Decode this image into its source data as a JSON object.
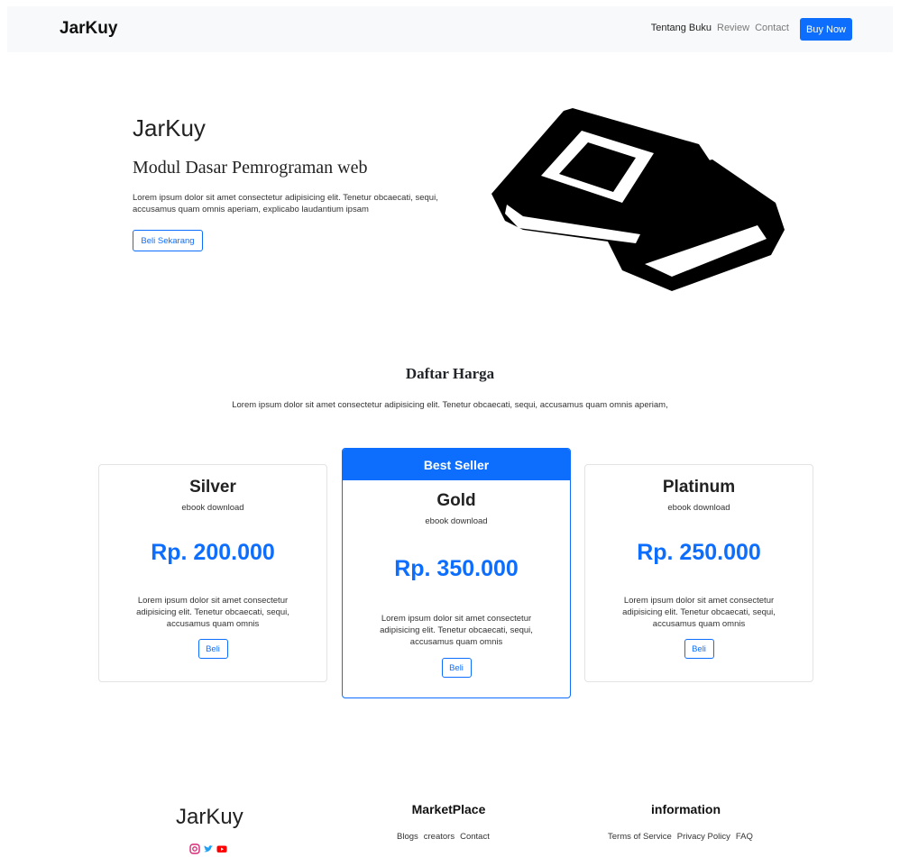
{
  "nav": {
    "brand": "JarKuy",
    "links": [
      "Tentang Buku",
      "Review",
      "Contact"
    ],
    "cta": "Buy Now"
  },
  "hero": {
    "title": "JarKuy",
    "subtitle": "Modul Dasar Pemrograman web",
    "text": "Lorem ipsum dolor sit amet consectetur adipisicing elit. Tenetur obcaecati, sequi, accusamus quam omnis aperiam, explicabo laudantium ipsam",
    "button": "Beli Sekarang",
    "image_icon": "books-icon"
  },
  "pricing": {
    "title": "Daftar Harga",
    "text": "Lorem ipsum dolor sit amet consectetur adipisicing elit. Tenetur obcaecati, sequi, accusamus quam omnis aperiam,",
    "plans": [
      {
        "name": "Silver",
        "desc": "ebook download",
        "price": "Rp. 200.000",
        "text": "Lorem ipsum dolor sit amet consectetur adipisicing elit. Tenetur obcaecati, sequi, accusamus quam omnis",
        "button": "Beli"
      },
      {
        "badge": "Best Seller",
        "name": "Gold",
        "desc": "ebook download",
        "price": "Rp. 350.000",
        "text": "Lorem ipsum dolor sit amet consectetur adipisicing elit. Tenetur obcaecati, sequi, accusamus quam omnis",
        "button": "Beli"
      },
      {
        "name": "Platinum",
        "desc": "ebook download",
        "price": "Rp. 250.000",
        "text": "Lorem ipsum dolor sit amet consectetur adipisicing elit. Tenetur obcaecati, sequi, accusamus quam omnis",
        "button": "Beli"
      }
    ]
  },
  "footer": {
    "brand": "JarKuy",
    "socials": [
      "instagram-icon",
      "twitter-icon",
      "youtube-icon"
    ],
    "marketplace": {
      "title": "MarketPlace",
      "links": [
        "Blogs",
        "creators",
        "Contact"
      ]
    },
    "information": {
      "title": "information",
      "links": [
        "Terms of Service",
        "Privacy Policy",
        "FAQ"
      ]
    }
  },
  "colors": {
    "primary": "#0d6efd",
    "navbar_bg": "#f8f9fa"
  }
}
